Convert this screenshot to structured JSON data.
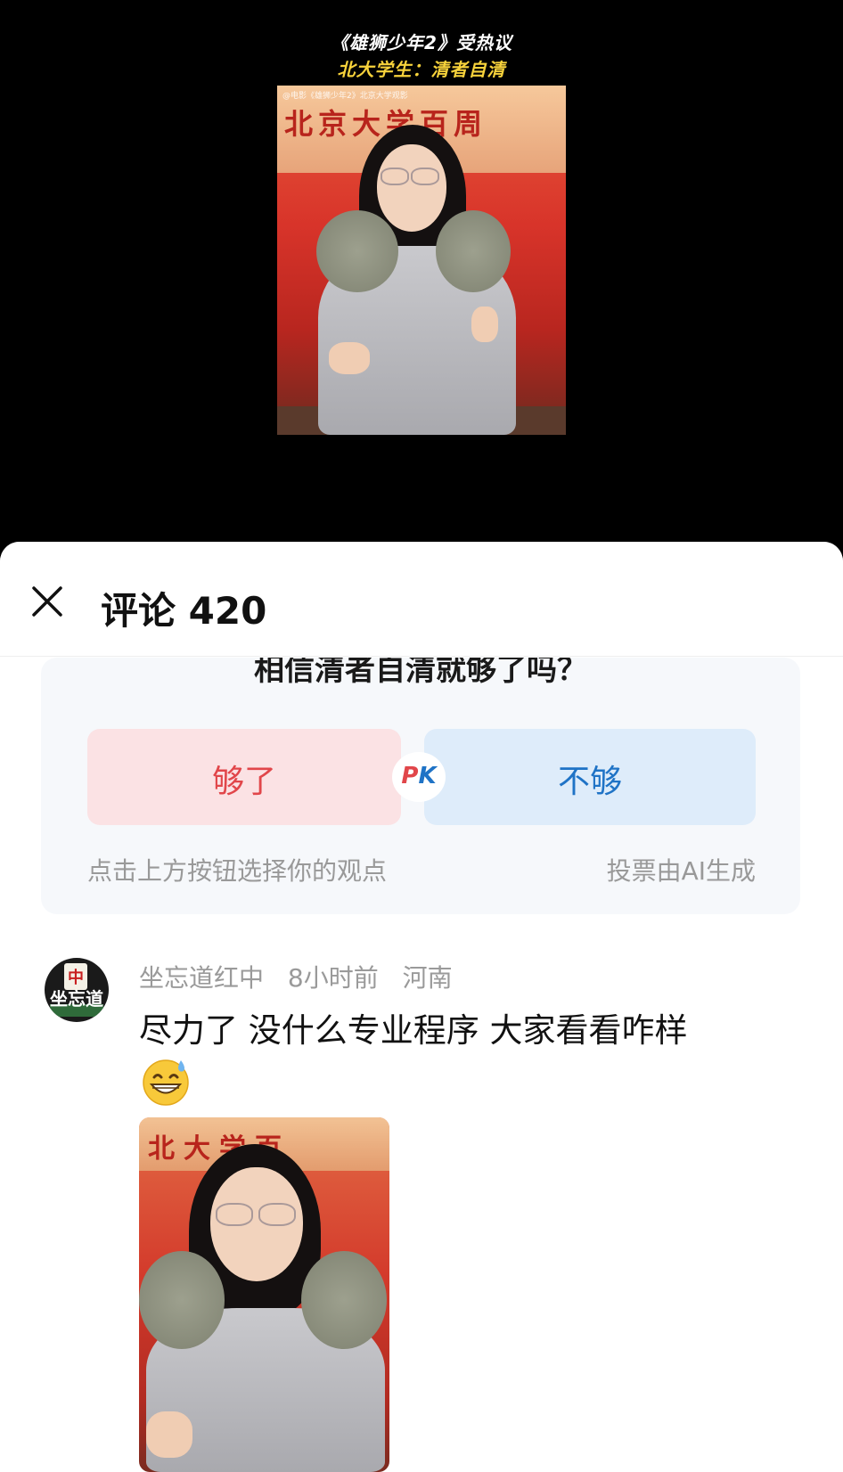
{
  "video": {
    "caption_line1": "《雄狮少年2》受热议",
    "caption_line2": "北大学生：清者自清",
    "watermark": "@电影《雄狮少年2》北京大学观影",
    "sign_text": "北京大学百周"
  },
  "comments_panel": {
    "title": "评论 420",
    "close_icon": "close-icon",
    "vote": {
      "question": "相信清者自清就够了吗？",
      "option_left": "够了",
      "option_right": "不够",
      "pk": {
        "p": "P",
        "k": "K"
      },
      "hint": "点击上方按钮选择你的观点",
      "ai_note": "投票由AI生成"
    },
    "comment": {
      "avatar_text": "坐忘道",
      "avatar_tile": "中",
      "username": "坐忘道红中",
      "time": "8小时前",
      "location": "河南",
      "text": "尽力了 没什么专业程序 大家看看咋样",
      "emoji": "grinning-sweat-emoji",
      "image_sign": "北大学百"
    }
  },
  "colors": {
    "caption_yellow": "#f7d23b",
    "option_left_bg": "#fbe2e4",
    "option_left_text": "#e1464a",
    "option_right_bg": "#deecfa",
    "option_right_text": "#1f73c6",
    "meta_gray": "#9a9a9a"
  }
}
